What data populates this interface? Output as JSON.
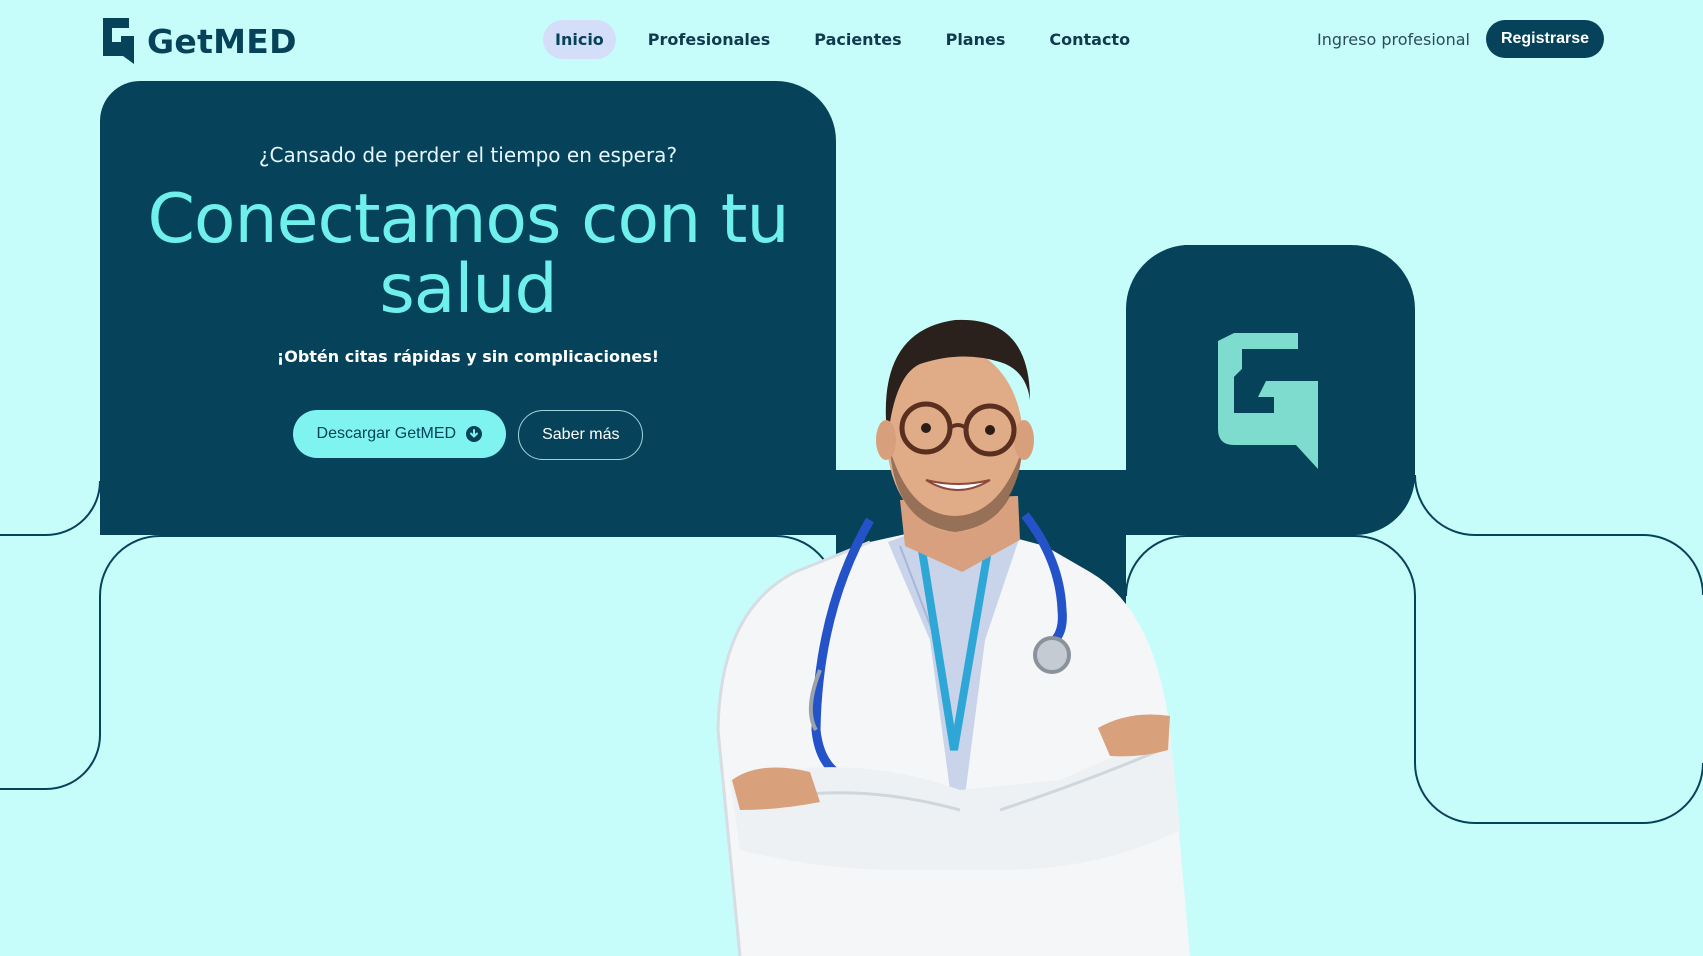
{
  "brand": {
    "name": "GetMED",
    "logo_icon": "getmed-logo-icon"
  },
  "nav": {
    "items": [
      {
        "label": "Inicio",
        "active": true
      },
      {
        "label": "Profesionales",
        "active": false
      },
      {
        "label": "Pacientes",
        "active": false
      },
      {
        "label": "Planes",
        "active": false
      },
      {
        "label": "Contacto",
        "active": false
      }
    ]
  },
  "auth": {
    "login_label": "Ingreso profesional",
    "register_label": "Registrarse"
  },
  "hero": {
    "kicker": "¿Cansado de perder el tiempo en espera?",
    "title": "Conectamos con tu salud",
    "subtitle": "¡Obtén citas rápidas y sin complicaciones!",
    "primary_button": "Descargar GetMED",
    "primary_button_icon": "download-circle-icon",
    "secondary_button": "Saber más"
  },
  "image": {
    "subject": "doctor-photo"
  },
  "colors": {
    "background": "#c6fdfb",
    "dark_teal": "#06435a",
    "accent_cyan": "#6ff0ec",
    "mint_logo": "#7ddccd",
    "active_nav": "#d5def9"
  }
}
